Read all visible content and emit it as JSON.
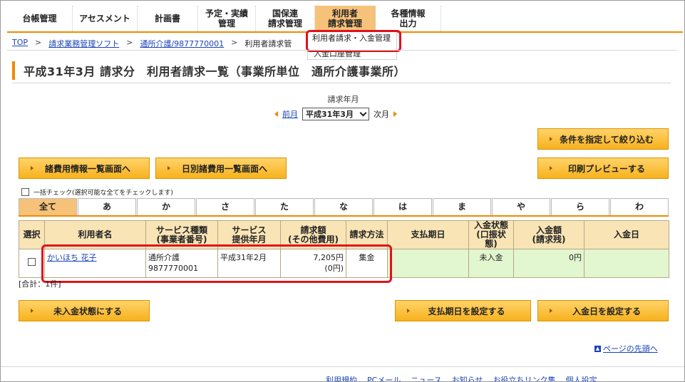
{
  "nav": {
    "items": [
      {
        "label": "台帳管理"
      },
      {
        "label": "アセスメント"
      },
      {
        "label": "計画書"
      },
      {
        "label": "予定・実績\n管理"
      },
      {
        "label": "国保連\n請求管理"
      },
      {
        "label": "利用者\n請求管理"
      },
      {
        "label": "各種情報\n出力"
      }
    ],
    "dropdown": [
      "利用者請求・入金管理",
      "入金口座管理"
    ]
  },
  "breadcrumb": [
    "TOP",
    "請求業務管理ソフト",
    "通所介護/9877770001",
    "利用者請求管"
  ],
  "title": "平成31年3月 請求分　利用者請求一覧（事業所単位　通所介護事業所）",
  "month": {
    "label": "請求年月",
    "prev": "前月",
    "selected": "平成31年3月",
    "next": "次月"
  },
  "buttons": {
    "filter": "条件を指定して絞り込む",
    "misc_fees": "諸費用情報一覧画面へ",
    "daily_fees": "日別諸費用一覧画面へ",
    "print_preview": "印刷プレビューする",
    "set_unpaid": "未入金状態にする",
    "set_payment_due": "支払期日を設定する",
    "set_deposit_date": "入金日を設定する"
  },
  "check_all": "一括チェック(選択可能な全てをチェックします)",
  "tabs": [
    "全て",
    "あ",
    "か",
    "さ",
    "た",
    "な",
    "は",
    "ま",
    "や",
    "ら",
    "わ"
  ],
  "table": {
    "headers": [
      "選択",
      "利用者名",
      "サービス種類\n(事業者番号)",
      "サービス\n提供年月",
      "請求額\n(その他費用)",
      "請求方法",
      "支払期日",
      "入金状態\n(口振状態)",
      "入金額\n(請求残)",
      "入金日"
    ],
    "rows": [
      {
        "name": "かいほち 花子",
        "service": "通所介護",
        "office_no": "9877770001",
        "month": "平成31年2月",
        "amount": "7,205円",
        "other": "(0円)",
        "method": "集金",
        "due": "",
        "status": "未入金",
        "paid": "0円",
        "date": ""
      }
    ]
  },
  "total": "[合計：1件]",
  "page_top": "ページの先頭へ",
  "footer": [
    "利用規約",
    "PCメール",
    "ニュース",
    "お知らせ",
    "お役立ちリンク集",
    "個人設定"
  ],
  "colors": {
    "accent": "#ef8a00",
    "header_bg": "#f9e4b6",
    "green_cell": "#e2f6cf",
    "highlight": "#e0121a"
  }
}
